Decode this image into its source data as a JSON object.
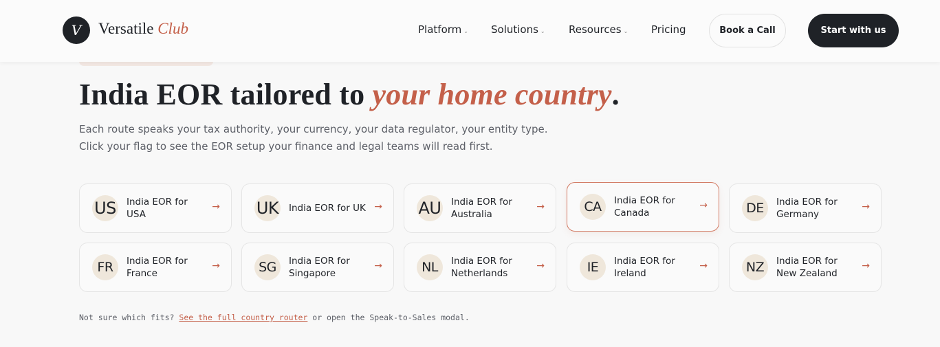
{
  "brand": {
    "badge": "V",
    "name_primary": "Versatile",
    "name_accent": "Club",
    "accent_color": "#c4604a",
    "dark_color": "#1f2227"
  },
  "nav": {
    "items": [
      {
        "label": "Platform",
        "has_dropdown": true,
        "chevron": "⌄"
      },
      {
        "label": "Solutions",
        "has_dropdown": true,
        "chevron": "⌄"
      },
      {
        "label": "Resources",
        "has_dropdown": true,
        "chevron": "⌄"
      },
      {
        "label": "Pricing",
        "has_dropdown": false,
        "chevron": ""
      }
    ],
    "book_call_label": "Book a Call",
    "start_label": "Start with us"
  },
  "hero": {
    "title_start": "India EOR tailored to ",
    "title_accent": "your home country",
    "title_end": ".",
    "subtitle_line1": "Each route speaks your tax authority, your currency, your data regulator, your entity type.",
    "subtitle_line2": "Click your flag to see the EOR setup your finance and legal teams will read first."
  },
  "countries": [
    {
      "code": "US",
      "label": "India EOR for USA",
      "arrow": "→",
      "selected": false
    },
    {
      "code": "UK",
      "label": "India EOR for UK",
      "arrow": "→",
      "selected": false
    },
    {
      "code": "AU",
      "label": "India EOR for Australia",
      "arrow": "→",
      "selected": false
    },
    {
      "code": "CA",
      "label": "India EOR for Canada",
      "arrow": "→",
      "selected": true
    },
    {
      "code": "DE",
      "label": "India EOR for Germany",
      "arrow": "→",
      "selected": false
    },
    {
      "code": "FR",
      "label": "India EOR for France",
      "arrow": "→",
      "selected": false
    },
    {
      "code": "SG",
      "label": "India EOR for Singapore",
      "arrow": "→",
      "selected": false
    },
    {
      "code": "NL",
      "label": "India EOR for Netherlands",
      "arrow": "→",
      "selected": false
    },
    {
      "code": "IE",
      "label": "India EOR for Ireland",
      "arrow": "→",
      "selected": false
    },
    {
      "code": "NZ",
      "label": "India EOR for New Zealand",
      "arrow": "→",
      "selected": false
    }
  ],
  "footer": {
    "prefix": "Not sure which fits? ",
    "link_label": "See the full country router",
    "suffix": " or open the Speak-to-Sales modal."
  }
}
